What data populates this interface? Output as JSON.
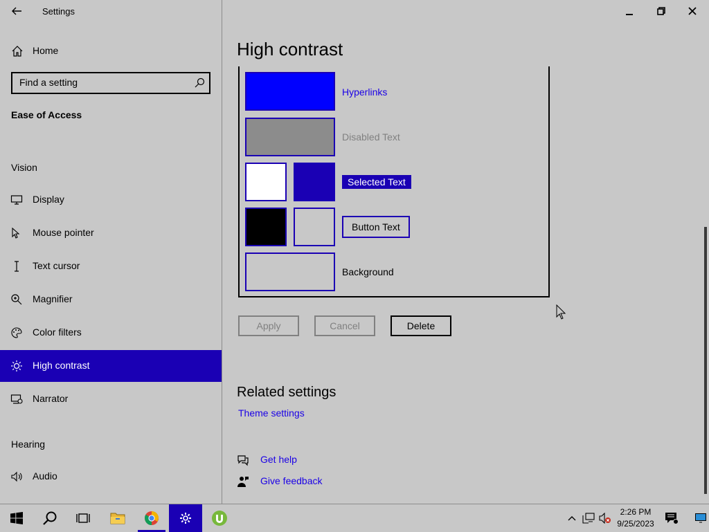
{
  "app": {
    "title": "Settings"
  },
  "sidebar": {
    "home_label": "Home",
    "search_placeholder": "Find a setting",
    "section_title": "Ease of Access",
    "group_vision": "Vision",
    "group_hearing": "Hearing",
    "items": [
      {
        "label": "Display",
        "icon": "monitor-icon"
      },
      {
        "label": "Mouse pointer",
        "icon": "mouse-pointer-icon"
      },
      {
        "label": "Text cursor",
        "icon": "text-cursor-icon"
      },
      {
        "label": "Magnifier",
        "icon": "magnifier-icon"
      },
      {
        "label": "Color filters",
        "icon": "palette-icon"
      },
      {
        "label": "High contrast",
        "icon": "sun-icon",
        "active": true
      },
      {
        "label": "Narrator",
        "icon": "narrator-icon"
      },
      {
        "label": "Audio",
        "icon": "speaker-icon"
      }
    ]
  },
  "main": {
    "heading": "High contrast",
    "colors": {
      "hyperlinks": "Hyperlinks",
      "disabled_text": "Disabled Text",
      "selected_text": "Selected Text",
      "button_text": "Button Text",
      "background": "Background",
      "swatch_colors": {
        "hyperlinks": "#0000ff",
        "disabled_text": "#8c8c8c",
        "selected_fg": "#ffffff",
        "selected_bg": "#1a00b4",
        "button_fg": "#000000",
        "button_bg": "#c8c8c8",
        "background": "#c8c8c8"
      }
    },
    "buttons": {
      "apply": "Apply",
      "cancel": "Cancel",
      "delete": "Delete"
    },
    "related_heading": "Related settings",
    "theme_settings": "Theme settings",
    "get_help": "Get help",
    "give_feedback": "Give feedback"
  },
  "taskbar": {
    "time": "2:26 PM",
    "date": "9/25/2023",
    "apps": [
      "start-icon",
      "search-icon",
      "task-view-icon",
      "file-explorer-icon",
      "chrome-icon",
      "settings-icon",
      "utorrent-icon"
    ]
  },
  "theme": {
    "accent": "#1a00b4",
    "link": "#1a00e6",
    "background": "#c8c8c8"
  }
}
